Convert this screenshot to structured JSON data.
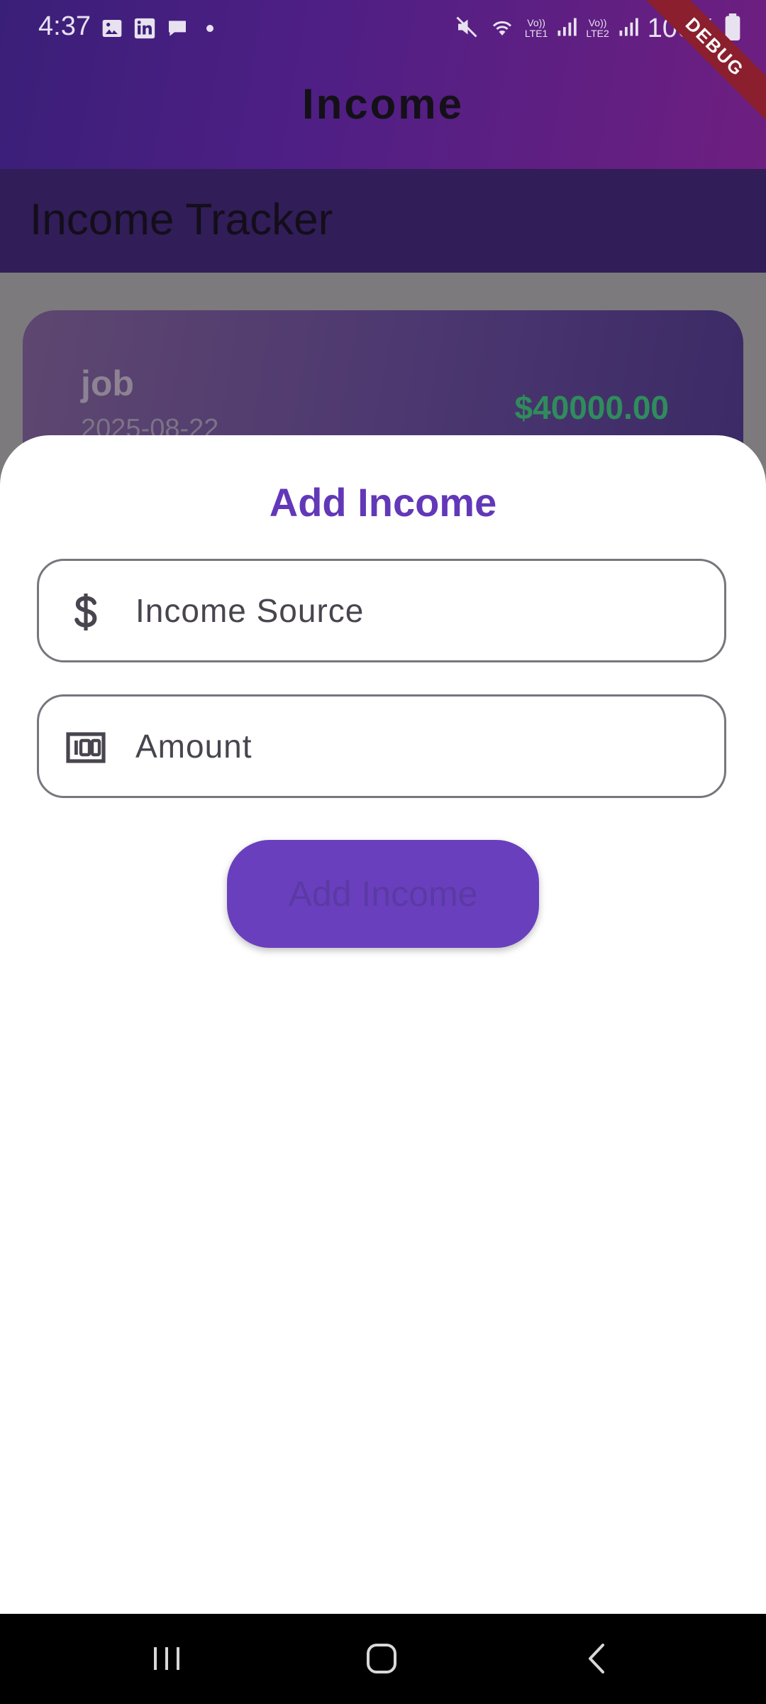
{
  "status_bar": {
    "time": "4:37",
    "battery": "100%",
    "sim1_label_top": "Vo))",
    "sim1_label_bottom": "LTE1",
    "sim2_label_top": "Vo))",
    "sim2_label_bottom": "LTE2",
    "icons_left": [
      "image-icon",
      "linkedin-icon",
      "chat-bubble-icon",
      "dot-icon"
    ],
    "icons_right": [
      "mute-icon",
      "wifi-icon",
      "signal-icon",
      "signal-icon",
      "battery-icon"
    ]
  },
  "app_bar": {
    "title": "Income",
    "debug_banner": "DEBUG"
  },
  "subheader": {
    "title": "Income Tracker"
  },
  "income_list": [
    {
      "source": "job",
      "date": "2025-08-22",
      "amount": "$40000.00"
    }
  ],
  "sheet": {
    "title": "Add Income",
    "source_field": {
      "placeholder": "Income Source",
      "value": "",
      "icon": "dollar-icon"
    },
    "amount_field": {
      "placeholder": "Amount",
      "value": "",
      "icon": "money-bill-icon"
    },
    "submit_label": "Add Income"
  },
  "colors": {
    "accent": "#6238b8",
    "button": "#6a3fbd",
    "amount_green": "#2f8c5c",
    "subheader_bg": "#311d57"
  },
  "nav_bar": {
    "buttons": [
      "recent-apps-icon",
      "home-icon",
      "back-icon"
    ]
  }
}
